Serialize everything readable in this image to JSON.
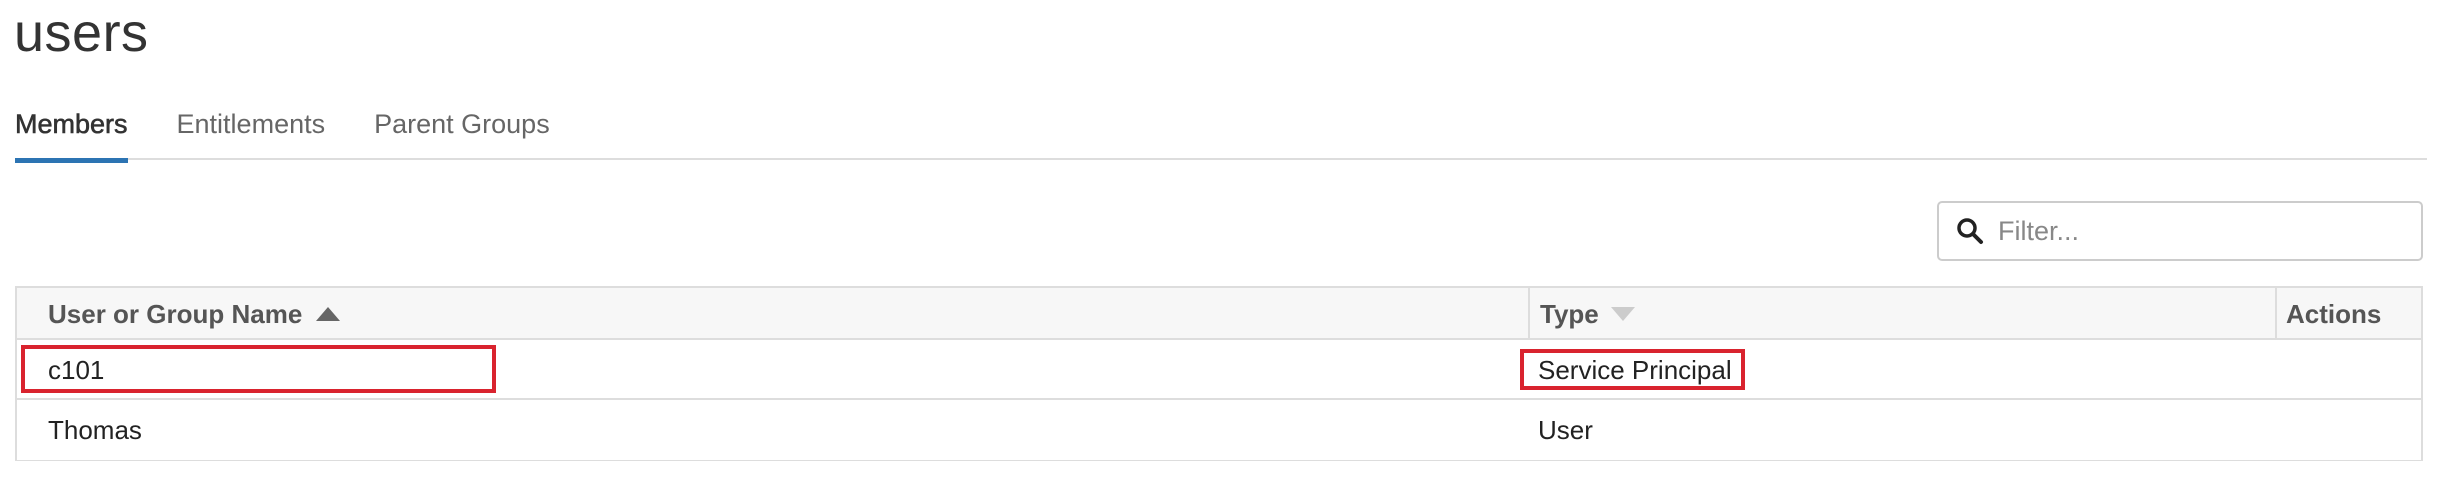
{
  "page": {
    "title": "users"
  },
  "tabs": [
    {
      "label": "Members",
      "active": true
    },
    {
      "label": "Entitlements",
      "active": false
    },
    {
      "label": "Parent Groups",
      "active": false
    }
  ],
  "filter": {
    "placeholder": "Filter...",
    "value": "",
    "icon": "search-icon"
  },
  "table": {
    "columns": {
      "name": {
        "label": "User or Group Name",
        "sort": "ascending"
      },
      "type": {
        "label": "Type",
        "sort": "descending-inactive"
      },
      "actions": {
        "label": "Actions"
      }
    },
    "rows": [
      {
        "name": "c101",
        "type": "Service Principal",
        "highlighted": true
      },
      {
        "name": "Thomas",
        "type": "User",
        "highlighted": false
      }
    ]
  },
  "colors": {
    "active_tab_underline": "#2c74b3",
    "highlight_border": "#d9232e"
  }
}
